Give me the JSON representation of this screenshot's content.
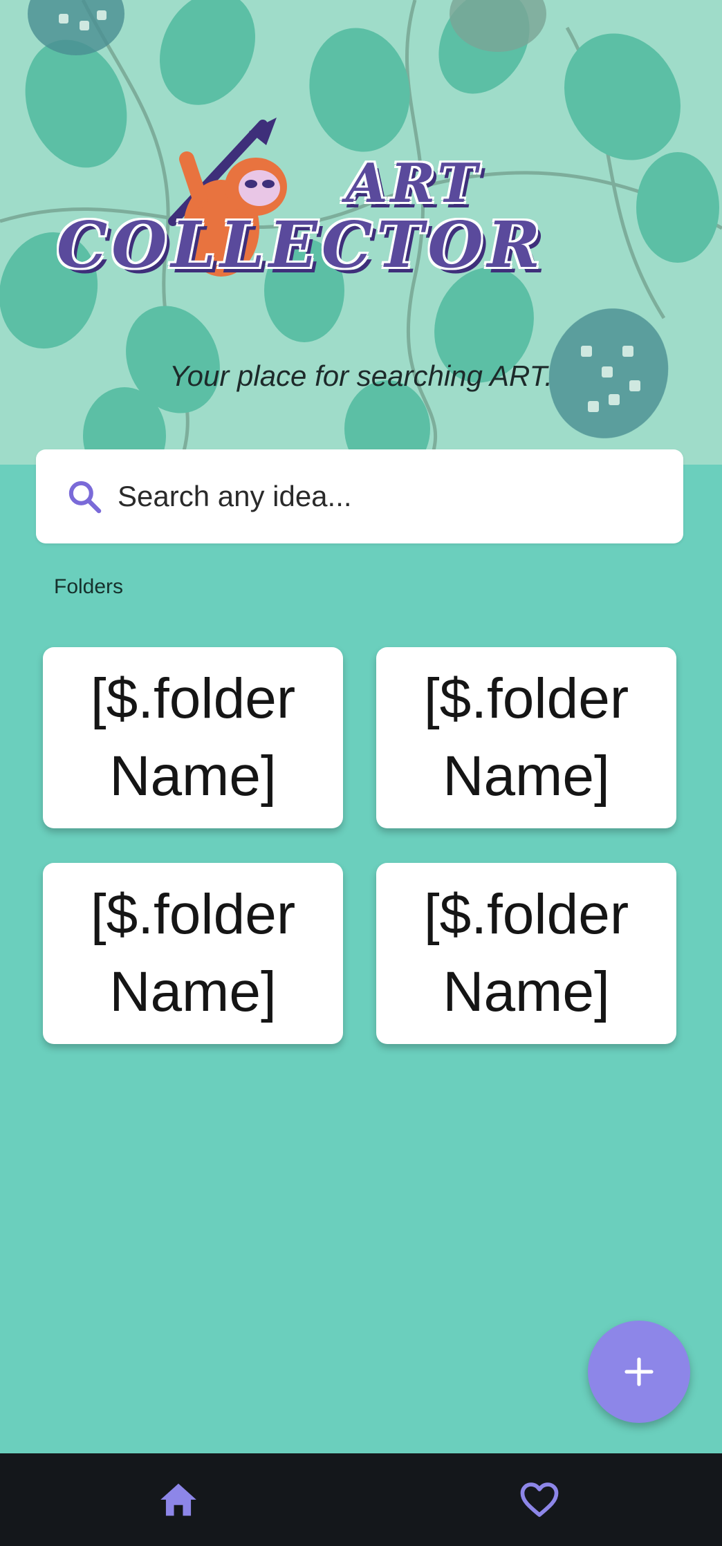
{
  "header": {
    "logo_line1": "ART",
    "logo_line2": "COLLECTOR",
    "tagline": "Your place for searching ART."
  },
  "search": {
    "placeholder": "Search any idea...",
    "value": "",
    "icon": "search-icon"
  },
  "folders": {
    "label": "Folders",
    "items": [
      {
        "name": "[$.folder Name]"
      },
      {
        "name": "[$.folder Name]"
      },
      {
        "name": "[$.folder Name]"
      },
      {
        "name": "[$.folder Name]"
      }
    ]
  },
  "fab": {
    "icon": "plus-icon"
  },
  "bottom_nav": {
    "items": [
      {
        "icon": "home-icon"
      },
      {
        "icon": "heart-icon"
      }
    ]
  },
  "colors": {
    "background": "#6bcfbd",
    "accent": "#8d86e8",
    "navbar": "#14171b",
    "logo": "#5a4a9c"
  }
}
